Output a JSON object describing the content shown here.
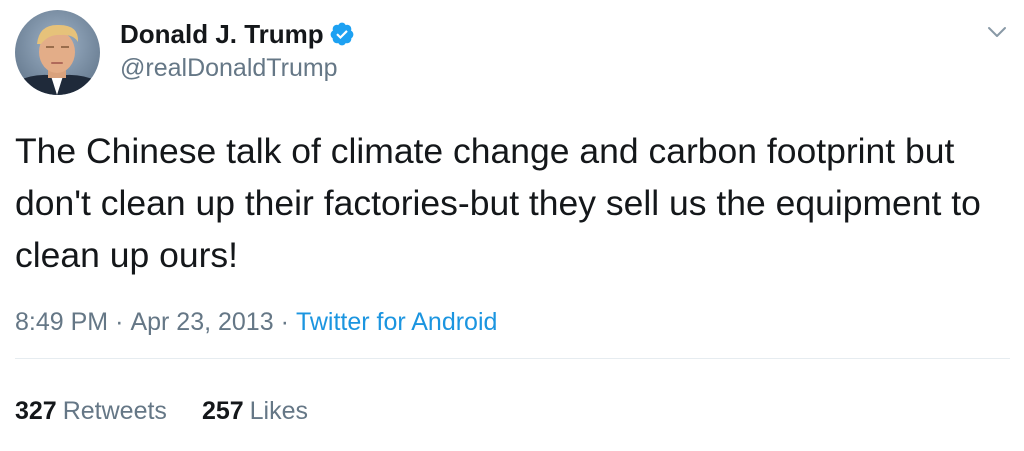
{
  "author": {
    "display_name": "Donald J. Trump",
    "handle": "@realDonaldTrump",
    "verified": true
  },
  "tweet": {
    "text": "The Chinese talk of climate change and carbon footprint but don't clean up their factories-but they sell us the equipment to clean up ours!",
    "time": "8:49 PM",
    "date": "Apr 23, 2013",
    "source": "Twitter for Android",
    "separator": "·"
  },
  "stats": {
    "retweets_count": "327",
    "retweets_label": "Retweets",
    "likes_count": "257",
    "likes_label": "Likes"
  },
  "icons": {
    "verified": "verified-badge-icon",
    "menu": "chevron-down-icon"
  },
  "colors": {
    "text": "#14171a",
    "secondary": "#657786",
    "link": "#1b95e0",
    "verified": "#1da1f2",
    "divider": "#e6ecf0"
  }
}
